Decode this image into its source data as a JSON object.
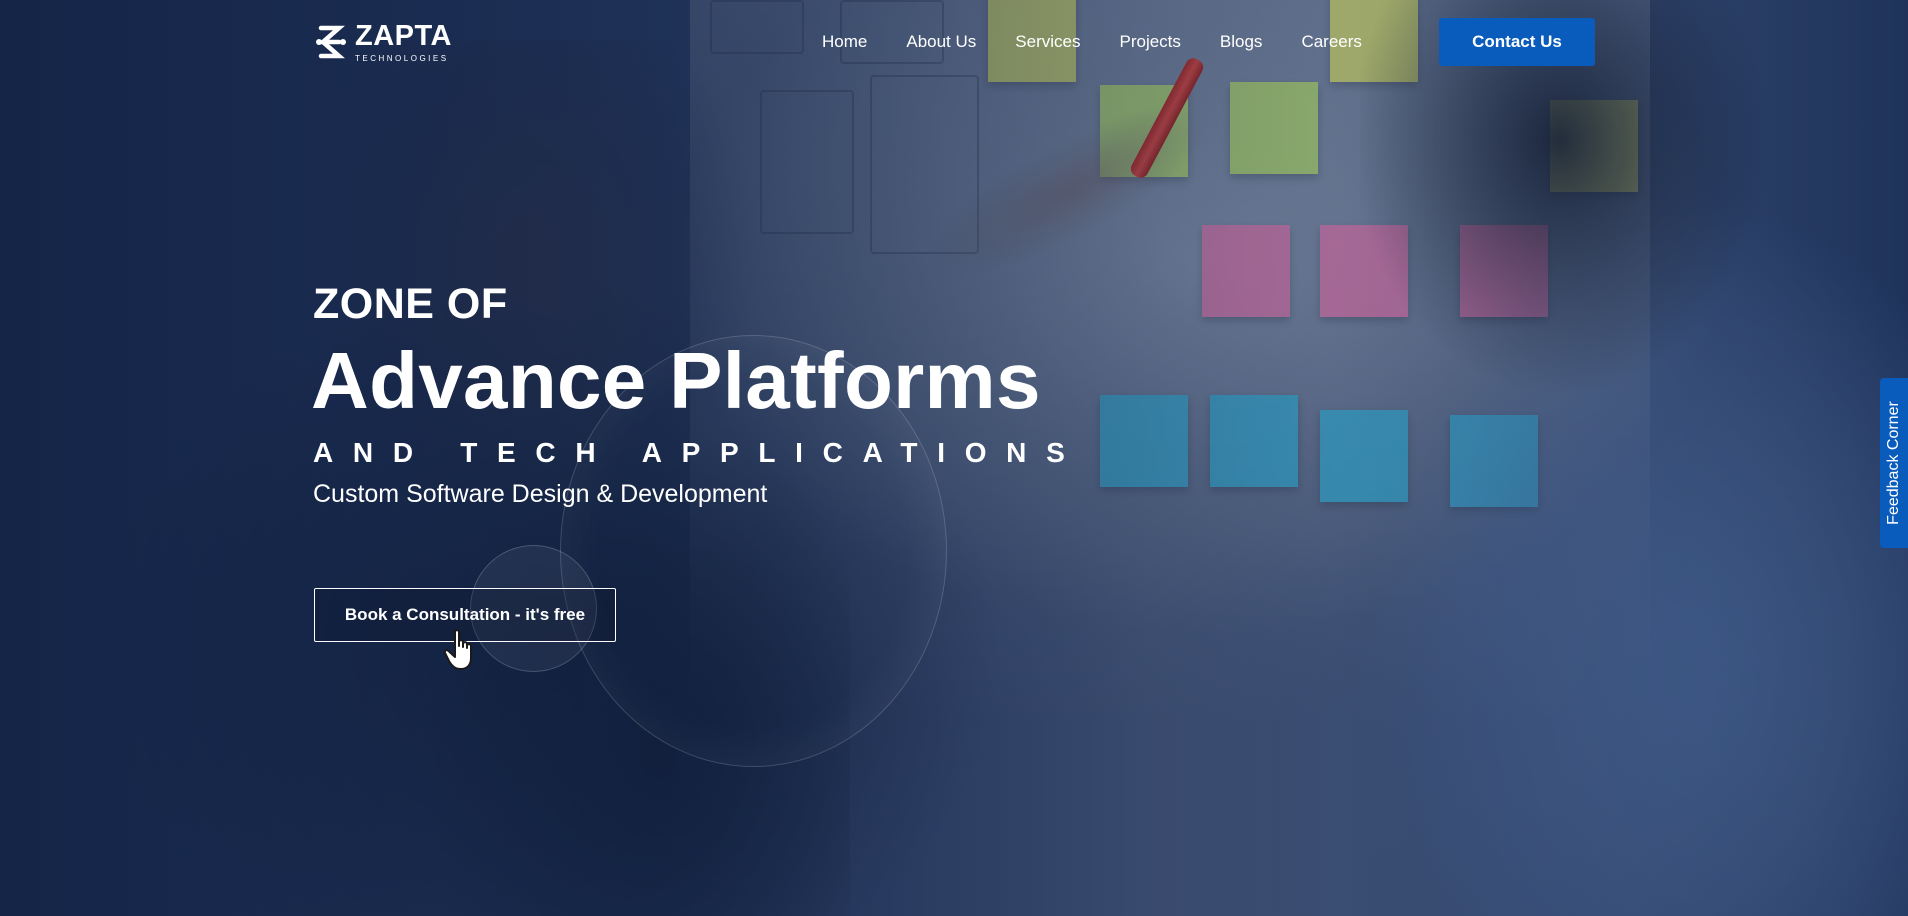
{
  "brand": {
    "name": "ZAPTA",
    "sub": "TECHNOLOGIES",
    "logo_icon": "zapta-logo-icon"
  },
  "nav": {
    "items": [
      {
        "label": "Home"
      },
      {
        "label": "About Us"
      },
      {
        "label": "Services"
      },
      {
        "label": "Projects"
      },
      {
        "label": "Blogs"
      },
      {
        "label": "Careers"
      }
    ],
    "contact_label": "Contact Us"
  },
  "hero": {
    "eyebrow": "ZONE OF",
    "headline": "Advance Platforms",
    "spaced": "AND TECH APPLICATIONS",
    "tagline": "Custom Software Design & Development",
    "cta_label": "Book a Consultation - it's free",
    "cursor_icon": "hand-pointer-icon"
  },
  "feedback": {
    "label": "Feedback Corner"
  },
  "colors": {
    "accent": "#0a5cbc",
    "overlay": "#1b2c4e",
    "text": "#ffffff"
  }
}
